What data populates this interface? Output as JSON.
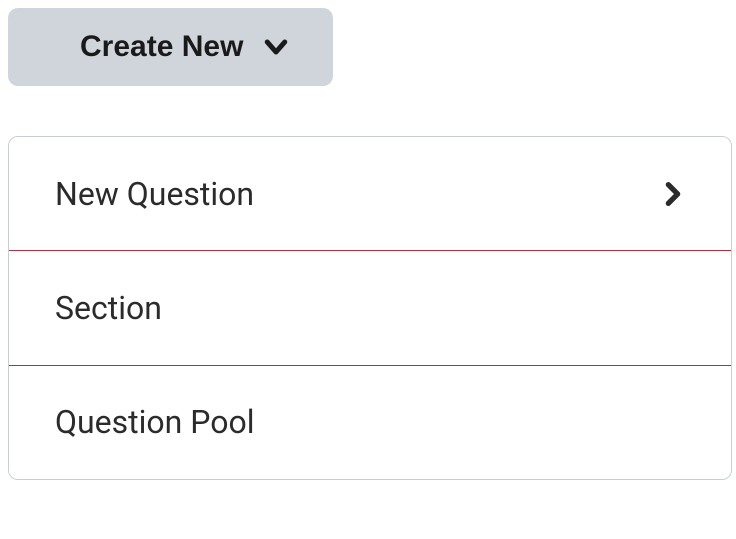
{
  "header": {
    "create_new_label": "Create New"
  },
  "menu": {
    "items": [
      {
        "label": "New Question",
        "has_submenu": true
      },
      {
        "label": "Section",
        "has_submenu": false,
        "highlighted": true
      },
      {
        "label": "Question Pool",
        "has_submenu": false
      }
    ]
  }
}
